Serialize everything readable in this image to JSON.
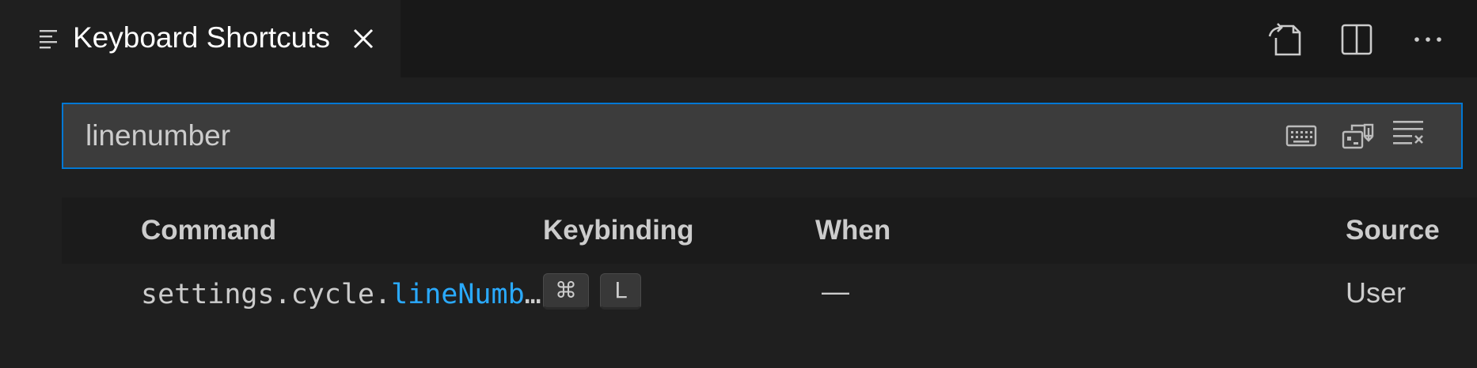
{
  "editor": {
    "tab_title": "Keyboard Shortcuts",
    "tab_icon": "list-lines-icon",
    "toolbar": {
      "open_json_icon": "open-file-icon",
      "split_icon": "split-editor-icon",
      "more_icon": "more-ellipsis-icon"
    }
  },
  "search": {
    "value": "linenumber",
    "actions": [
      "keyboard-icon",
      "record-keys-icon",
      "clear-search-icon"
    ]
  },
  "table": {
    "headers": {
      "command": "Command",
      "keybinding": "Keybinding",
      "when": "When",
      "source": "Source"
    },
    "rows": [
      {
        "command_prefix": "settings.cycle.",
        "command_match": "lineNumb",
        "command_ellipsis": "…",
        "keys": [
          "⌘",
          "L"
        ],
        "when": "—",
        "source": "User"
      }
    ]
  },
  "colors": {
    "accent": "#0078d4",
    "highlight": "#2aaaff",
    "background": "#1f1f1f",
    "titlebar": "#181818",
    "input_bg": "#3c3c3c"
  }
}
